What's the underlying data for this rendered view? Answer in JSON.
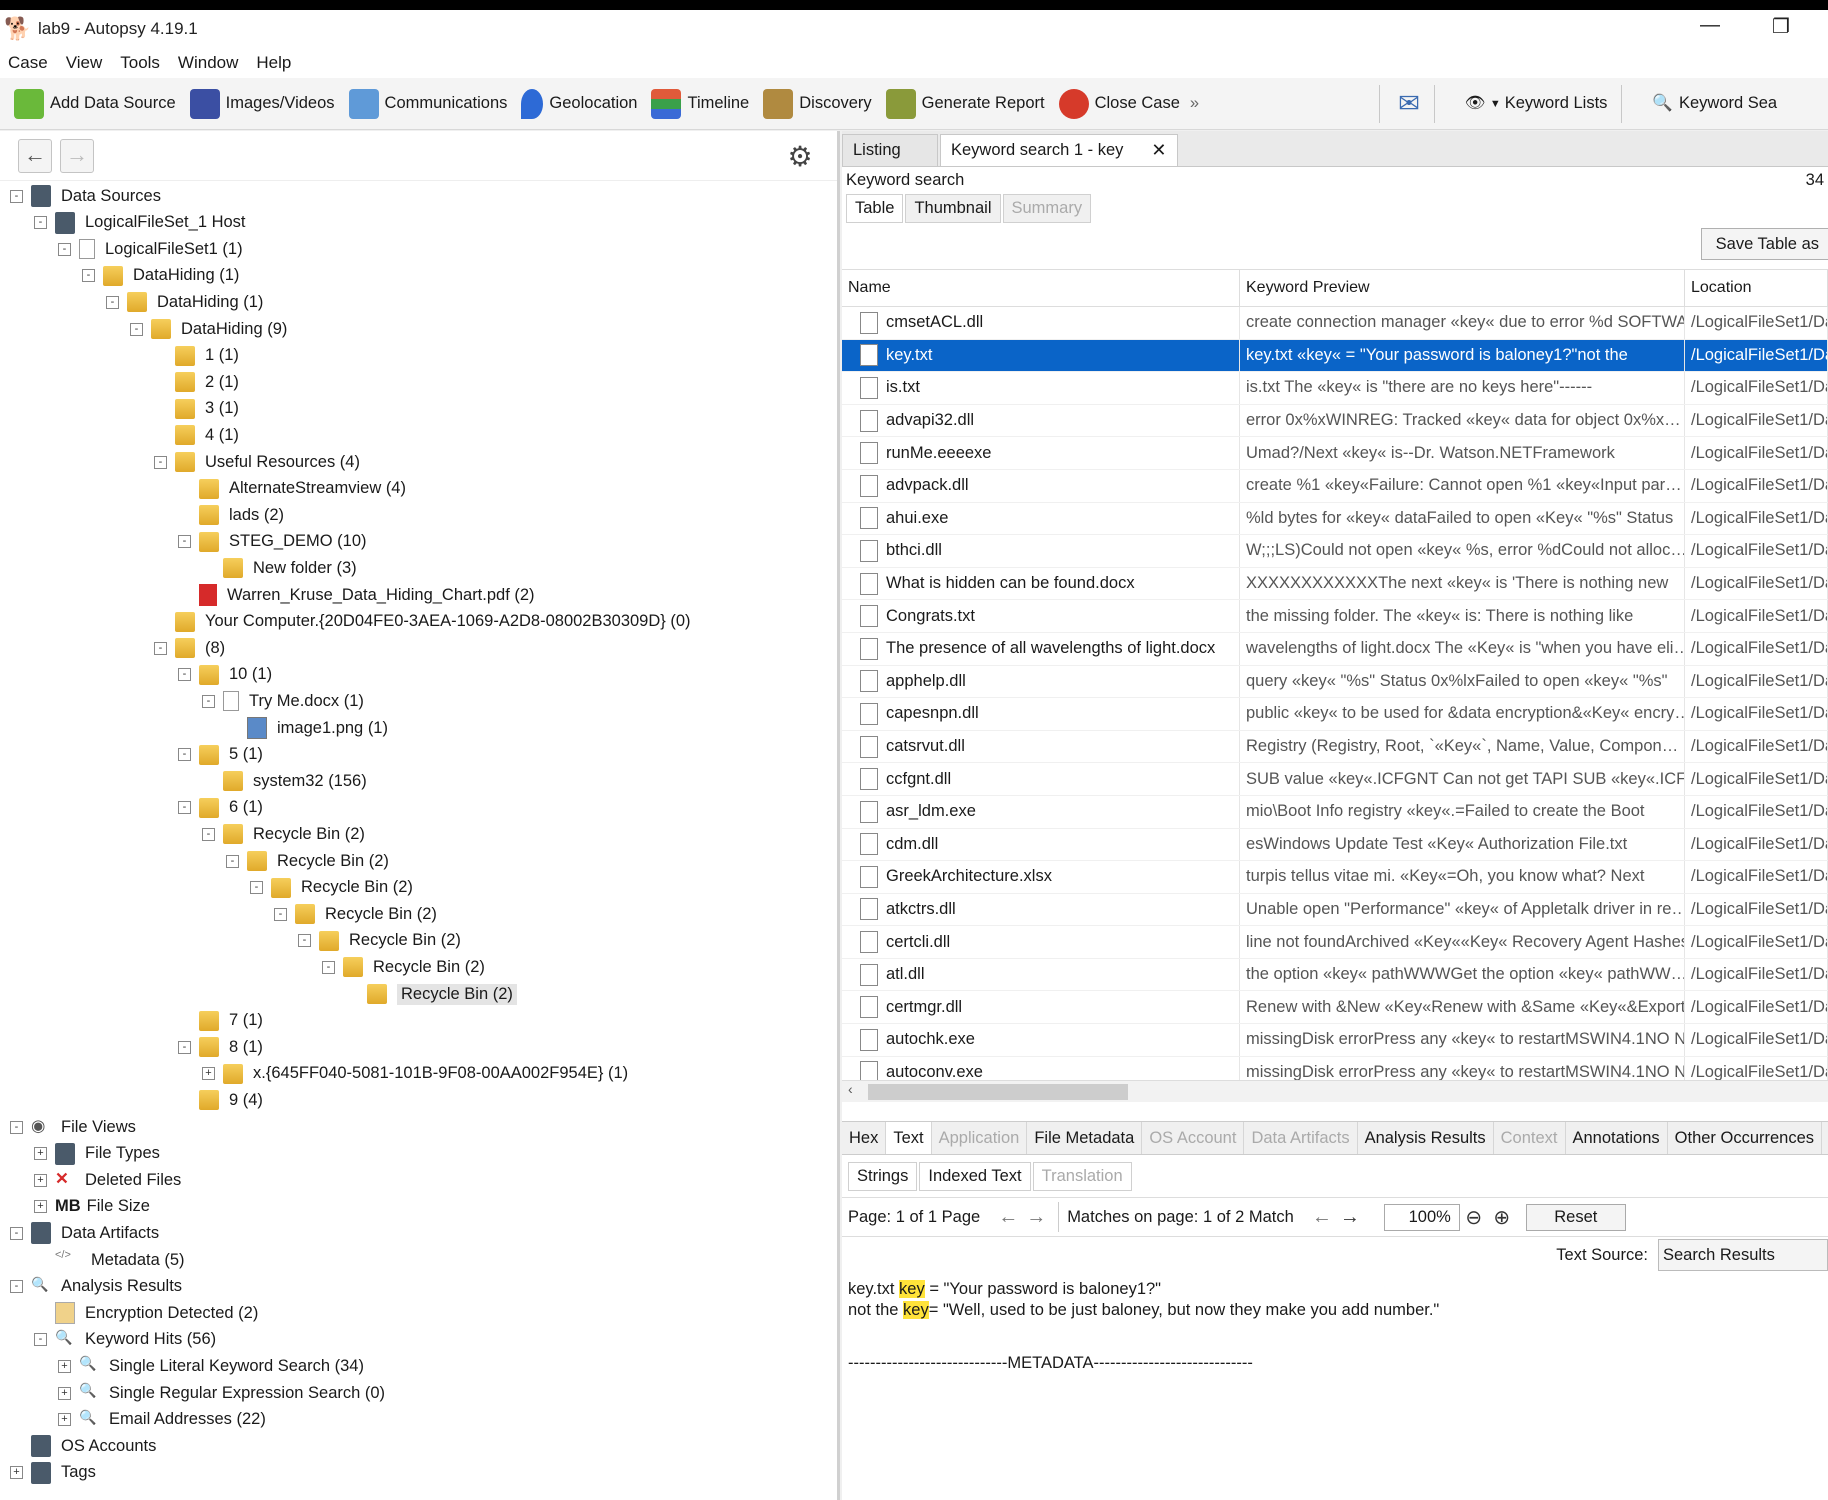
{
  "window": {
    "title": "lab9 - Autopsy 4.19.1",
    "minimize": "—",
    "restore": "❐"
  },
  "menu": [
    "Case",
    "View",
    "Tools",
    "Window",
    "Help"
  ],
  "toolbar": {
    "items": [
      {
        "label": "Add Data Source",
        "icon": "add-data-source-icon",
        "color": "#6ab93a"
      },
      {
        "label": "Images/Videos",
        "icon": "images-videos-icon",
        "color": "#3b4fa3"
      },
      {
        "label": "Communications",
        "icon": "communications-icon",
        "color": "#5f9ad8"
      },
      {
        "label": "Geolocation",
        "icon": "geolocation-icon",
        "color": "#2d6ad6"
      },
      {
        "label": "Timeline",
        "icon": "timeline-icon",
        "color": "#e05a3a"
      },
      {
        "label": "Discovery",
        "icon": "discovery-icon",
        "color": "#b08a40"
      },
      {
        "label": "Generate Report",
        "icon": "generate-report-icon",
        "color": "#8a9a3a"
      },
      {
        "label": "Close Case",
        "icon": "close-case-icon",
        "color": "#d63a2a"
      }
    ],
    "overflow": "»",
    "keyword_lists": "Keyword Lists",
    "keyword_search": "Keyword Sea"
  },
  "tree": [
    {
      "label": "Data Sources",
      "level": 0,
      "exp": "-",
      "icon": "data-sources-icon"
    },
    {
      "label": "LogicalFileSet_1 Host",
      "level": 1,
      "exp": "-",
      "icon": "host-icon"
    },
    {
      "label": "LogicalFileSet1 (1)",
      "level": 2,
      "exp": "-",
      "icon": "logical-fileset-icon"
    },
    {
      "label": "DataHiding (1)",
      "level": 3,
      "exp": "-",
      "icon": "folder-icon"
    },
    {
      "label": "DataHiding (1)",
      "level": 4,
      "exp": "-",
      "icon": "folder-icon"
    },
    {
      "label": "DataHiding (9)",
      "level": 5,
      "exp": "-",
      "icon": "folder-icon"
    },
    {
      "label": "1 (1)",
      "level": 6,
      "exp": "",
      "icon": "folder-icon"
    },
    {
      "label": "2 (1)",
      "level": 6,
      "exp": "",
      "icon": "folder-icon"
    },
    {
      "label": "3 (1)",
      "level": 6,
      "exp": "",
      "icon": "folder-icon"
    },
    {
      "label": "4 (1)",
      "level": 6,
      "exp": "",
      "icon": "folder-icon"
    },
    {
      "label": "Useful Resources (4)",
      "level": 6,
      "exp": "-",
      "icon": "folder-icon"
    },
    {
      "label": "AlternateStreamview (4)",
      "level": 7,
      "exp": "",
      "icon": "folder-icon"
    },
    {
      "label": "lads (2)",
      "level": 7,
      "exp": "",
      "icon": "folder-icon"
    },
    {
      "label": "STEG_DEMO (10)",
      "level": 7,
      "exp": "-",
      "icon": "folder-icon"
    },
    {
      "label": "New folder (3)",
      "level": 8,
      "exp": "",
      "icon": "folder-icon"
    },
    {
      "label": "Warren_Kruse_Data_Hiding_Chart.pdf (2)",
      "level": 7,
      "exp": "",
      "icon": "pdf-icon"
    },
    {
      "label": "Your Computer.{20D04FE0-3AEA-1069-A2D8-08002B30309D} (0)",
      "level": 6,
      "exp": "",
      "icon": "folder-icon"
    },
    {
      "label": "(8)",
      "level": 6,
      "exp": "-",
      "icon": "folder-icon"
    },
    {
      "label": "10 (1)",
      "level": 7,
      "exp": "-",
      "icon": "folder-icon"
    },
    {
      "label": "Try Me.docx (1)",
      "level": 8,
      "exp": "-",
      "icon": "docx-icon"
    },
    {
      "label": "image1.png (1)",
      "level": 9,
      "exp": "",
      "icon": "image-icon"
    },
    {
      "label": "5 (1)",
      "level": 7,
      "exp": "-",
      "icon": "folder-icon"
    },
    {
      "label": "system32 (156)",
      "level": 8,
      "exp": "",
      "icon": "folder-icon"
    },
    {
      "label": "6 (1)",
      "level": 7,
      "exp": "-",
      "icon": "folder-icon"
    },
    {
      "label": "Recycle Bin (2)",
      "level": 8,
      "exp": "-",
      "icon": "folder-icon"
    },
    {
      "label": "Recycle Bin (2)",
      "level": 9,
      "exp": "-",
      "icon": "folder-icon"
    },
    {
      "label": "Recycle Bin (2)",
      "level": 10,
      "exp": "-",
      "icon": "folder-icon"
    },
    {
      "label": "Recycle Bin (2)",
      "level": 11,
      "exp": "-",
      "icon": "folder-icon"
    },
    {
      "label": "Recycle Bin (2)",
      "level": 12,
      "exp": "-",
      "icon": "folder-icon"
    },
    {
      "label": "Recycle Bin (2)",
      "level": 13,
      "exp": "-",
      "icon": "folder-icon"
    },
    {
      "label": "Recycle Bin (2)",
      "level": 14,
      "exp": "",
      "icon": "folder-icon",
      "selected": true
    },
    {
      "label": "7 (1)",
      "level": 7,
      "exp": "",
      "icon": "folder-icon"
    },
    {
      "label": "8 (1)",
      "level": 7,
      "exp": "-",
      "icon": "folder-icon"
    },
    {
      "label": "x.{645FF040-5081-101B-9F08-00AA002F954E} (1)",
      "level": 8,
      "exp": "+",
      "icon": "folder-icon"
    },
    {
      "label": "9 (4)",
      "level": 7,
      "exp": "",
      "icon": "folder-icon"
    },
    {
      "label": "File Views",
      "level": 0,
      "exp": "-",
      "icon": "file-views-icon"
    },
    {
      "label": "File Types",
      "level": 1,
      "exp": "+",
      "icon": "file-types-icon"
    },
    {
      "label": "Deleted Files",
      "level": 1,
      "exp": "+",
      "icon": "deleted-files-icon"
    },
    {
      "label": "File Size",
      "level": 1,
      "exp": "+",
      "icon": "file-size-icon",
      "prefix": "MB"
    },
    {
      "label": "Data Artifacts",
      "level": 0,
      "exp": "-",
      "icon": "data-artifacts-icon"
    },
    {
      "label": "Metadata (5)",
      "level": 1,
      "exp": "",
      "icon": "metadata-icon"
    },
    {
      "label": "Analysis Results",
      "level": 0,
      "exp": "-",
      "icon": "analysis-results-icon"
    },
    {
      "label": "Encryption Detected (2)",
      "level": 1,
      "exp": "",
      "icon": "encryption-icon"
    },
    {
      "label": "Keyword Hits (56)",
      "level": 1,
      "exp": "-",
      "icon": "keyword-hits-icon"
    },
    {
      "label": "Single Literal Keyword Search (34)",
      "level": 2,
      "exp": "+",
      "icon": "search-icon"
    },
    {
      "label": "Single Regular Expression Search (0)",
      "level": 2,
      "exp": "+",
      "icon": "search-icon"
    },
    {
      "label": "Email Addresses (22)",
      "level": 2,
      "exp": "+",
      "icon": "search-icon"
    },
    {
      "label": "OS Accounts",
      "level": 0,
      "exp": "",
      "icon": "os-accounts-icon"
    },
    {
      "label": "Tags",
      "level": 0,
      "exp": "+",
      "icon": "tags-icon"
    }
  ],
  "results_tabs": {
    "listing": "Listing",
    "keyword": "Keyword search 1 - key",
    "close": "✕"
  },
  "results_header": {
    "title": "Keyword search",
    "count": "34"
  },
  "view_tabs": [
    "Table",
    "Thumbnail",
    "Summary"
  ],
  "save_table": "Save Table as",
  "table": {
    "columns": [
      "Name",
      "Keyword Preview",
      "Location"
    ],
    "rows": [
      {
        "name": "cmsetACL.dll",
        "preview": "create connection manager «key« due to error %d SOFTWA",
        "location": "/LogicalFileSet1/Dat"
      },
      {
        "name": "key.txt",
        "preview": "key.txt «key« = \"Your password is baloney1?\"not the",
        "location": "/LogicalFileSet1/Dat",
        "selected": true
      },
      {
        "name": "is.txt",
        "preview": "is.txt The «key« is \"there are no keys here\"------",
        "location": "/LogicalFileSet1/Dat"
      },
      {
        "name": "advapi32.dll",
        "preview": "error 0x%xWINREG: Tracked «key« data for object 0x%x…",
        "location": "/LogicalFileSet1/Dat"
      },
      {
        "name": "runMe.eeeexe",
        "preview": "Umad?/Next «key« is--Dr. Watson.NETFramework",
        "location": "/LogicalFileSet1/Dat"
      },
      {
        "name": "advpack.dll",
        "preview": "create %1 «key«Failure: Cannot open %1 «key«Input par…",
        "location": "/LogicalFileSet1/Dat"
      },
      {
        "name": "ahui.exe",
        "preview": "%ld bytes for «key« dataFailed to open «Key« \"%s\" Status",
        "location": "/LogicalFileSet1/Dat"
      },
      {
        "name": "bthci.dll",
        "preview": "W;;;LS)Could not open «key« %s, error %dCould not alloc…",
        "location": "/LogicalFileSet1/Dat"
      },
      {
        "name": "What is hidden can be found.docx",
        "preview": "XXXXXXXXXXXXThe next «key« is 'There is nothing new",
        "location": "/LogicalFileSet1/Dat"
      },
      {
        "name": "Congrats.txt",
        "preview": "the missing folder. The «key« is: There is nothing like",
        "location": "/LogicalFileSet1/Dat"
      },
      {
        "name": "The presence of all wavelengths of light.docx",
        "preview": "wavelengths of light.docx The «Key« is \"when you have eli…",
        "location": "/LogicalFileSet1/Dat"
      },
      {
        "name": "apphelp.dll",
        "preview": "query «key« \"%s\" Status 0x%lxFailed to open «key« \"%s\"",
        "location": "/LogicalFileSet1/Dat"
      },
      {
        "name": "capesnpn.dll",
        "preview": "public «key« to be used for &data encryption&«Key« encry…",
        "location": "/LogicalFileSet1/Dat"
      },
      {
        "name": "catsrvut.dll",
        "preview": "Registry (Registry, Root, `«Key«`, Name, Value, Compon…",
        "location": "/LogicalFileSet1/Dat"
      },
      {
        "name": "ccfgnt.dll",
        "preview": "SUB value «key«.ICFGNT Can not get TAPI SUB «key«.ICF…",
        "location": "/LogicalFileSet1/Dat"
      },
      {
        "name": "asr_ldm.exe",
        "preview": "mio\\Boot Info registry «key«.=Failed to create the Boot",
        "location": "/LogicalFileSet1/Dat"
      },
      {
        "name": "cdm.dll",
        "preview": "esWindows Update Test «Key« Authorization File.txt",
        "location": "/LogicalFileSet1/Dat"
      },
      {
        "name": "GreekArchitecture.xlsx",
        "preview": "turpis tellus vitae mi.      «Key«=Oh, you know what? Next",
        "location": "/LogicalFileSet1/Dat"
      },
      {
        "name": "atkctrs.dll",
        "preview": "Unable open \"Performance\" «key« of Appletalk driver in re…",
        "location": "/LogicalFileSet1/Dat"
      },
      {
        "name": "certcli.dll",
        "preview": "line not foundArchived «Key««Key« Recovery Agent Hashes",
        "location": "/LogicalFileSet1/Dat"
      },
      {
        "name": "atl.dll",
        "preview": "the option «key« pathWWWGet the option «key« pathWW…",
        "location": "/LogicalFileSet1/Dat"
      },
      {
        "name": "certmgr.dll",
        "preview": "Renew with &New «Key«Renew with &Same «Key«&Export…",
        "location": "/LogicalFileSet1/Dat"
      },
      {
        "name": "autochk.exe",
        "preview": "missingDisk errorPress any «key« to restartMSWIN4.1NO N…",
        "location": "/LogicalFileSet1/Dat"
      },
      {
        "name": "autoconv.exe",
        "preview": "missingDisk errorPress any «key« to restartMSWIN4.1NO N…",
        "location": "/LogicalFileSet1/Dat"
      }
    ]
  },
  "viewer_tabs": [
    {
      "label": "Hex",
      "state": "normal"
    },
    {
      "label": "Text",
      "state": "active"
    },
    {
      "label": "Application",
      "state": "disabled"
    },
    {
      "label": "File Metadata",
      "state": "normal"
    },
    {
      "label": "OS Account",
      "state": "disabled"
    },
    {
      "label": "Data Artifacts",
      "state": "disabled"
    },
    {
      "label": "Analysis Results",
      "state": "normal"
    },
    {
      "label": "Context",
      "state": "disabled"
    },
    {
      "label": "Annotations",
      "state": "normal"
    },
    {
      "label": "Other Occurrences",
      "state": "normal"
    }
  ],
  "text_tabs": [
    {
      "label": "Strings",
      "state": "normal"
    },
    {
      "label": "Indexed Text",
      "state": "active"
    },
    {
      "label": "Translation",
      "state": "disabled"
    }
  ],
  "pager": {
    "page_label": "Page:",
    "page": "1",
    "of": "of",
    "pages": "1",
    "page_word": "Page",
    "matches_label": "Matches on page:",
    "match": "1",
    "matches": "2",
    "match_word": "Match",
    "zoom": "100%",
    "reset": "Reset"
  },
  "text_source": {
    "label": "Text Source:",
    "value": "Search Results"
  },
  "content": {
    "l1_pre": "key.txt ",
    "l1_key": "key",
    "l1_post": " = \"Your password is baloney1?\"",
    "l2_pre": "not the ",
    "l2_key": "key",
    "l2_post": "= \"Well, used to be just baloney, but now they make you add number.\"",
    "metadata": "-----------------------------METADATA-----------------------------"
  },
  "colors": {
    "selection": "#0a64c8",
    "highlight": "#ffe33a"
  }
}
